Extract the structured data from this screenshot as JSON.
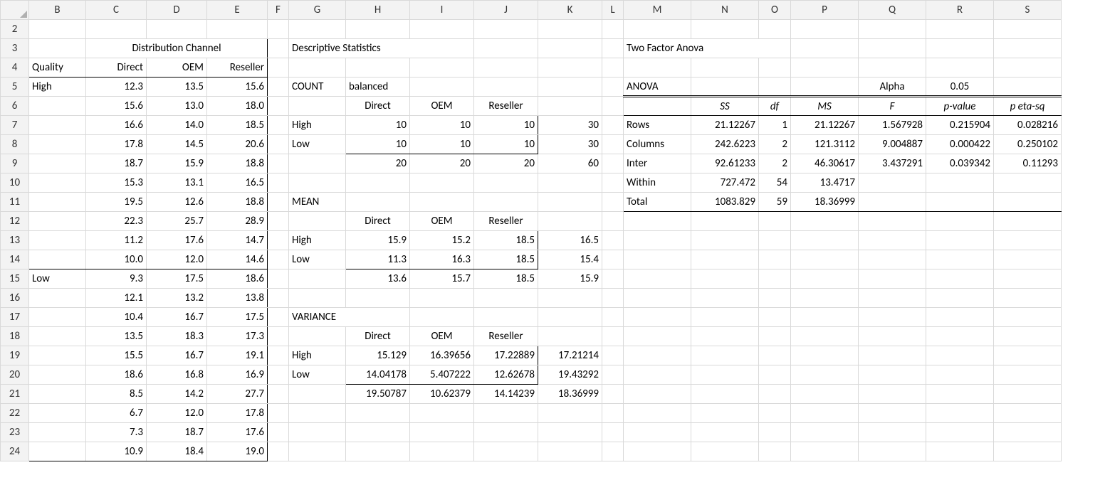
{
  "columns": [
    "B",
    "C",
    "D",
    "E",
    "F",
    "G",
    "H",
    "I",
    "J",
    "K",
    "L",
    "M",
    "N",
    "O",
    "P",
    "Q",
    "R",
    "S"
  ],
  "rows_shown": [
    "2",
    "3",
    "4",
    "5",
    "6",
    "7",
    "8",
    "9",
    "10",
    "11",
    "12",
    "13",
    "14",
    "15",
    "16",
    "17",
    "18",
    "19",
    "20",
    "21",
    "22",
    "23",
    "24"
  ],
  "labels": {
    "dist_channel": "Distribution Channel",
    "quality": "Quality",
    "direct": "Direct",
    "oem": "OEM",
    "reseller": "Reseller",
    "high": "High",
    "low": "Low",
    "desc_stats": "Descriptive Statistics",
    "count": "COUNT",
    "balanced": "balanced",
    "mean": "MEAN",
    "variance": "VARIANCE",
    "two_factor": "Two Factor Anova",
    "anova": "ANOVA",
    "alpha": "Alpha",
    "alpha_val": "0.05",
    "SS": "SS",
    "df": "df",
    "MS": "MS",
    "F": "F",
    "pvalue": "p-value",
    "petasq": "p eta-sq",
    "rows": "Rows",
    "cols": "Columns",
    "inter": "Inter",
    "within": "Within",
    "total": "Total"
  },
  "data": {
    "high": {
      "direct": [
        "12.3",
        "15.6",
        "16.6",
        "17.8",
        "18.7",
        "15.3",
        "19.5",
        "22.3",
        "11.2",
        "10.0"
      ],
      "oem": [
        "13.5",
        "13.0",
        "14.0",
        "14.5",
        "15.9",
        "13.1",
        "12.6",
        "25.7",
        "17.6",
        "12.0"
      ],
      "reseller": [
        "15.6",
        "18.0",
        "18.5",
        "20.6",
        "18.8",
        "16.5",
        "18.8",
        "28.9",
        "14.7",
        "14.6"
      ]
    },
    "low": {
      "direct": [
        "9.3",
        "12.1",
        "10.4",
        "13.5",
        "15.5",
        "18.6",
        "8.5",
        "6.7",
        "7.3",
        "10.9"
      ],
      "oem": [
        "17.5",
        "13.2",
        "16.7",
        "18.3",
        "16.7",
        "16.8",
        "14.2",
        "12.0",
        "18.7",
        "18.4"
      ],
      "reseller": [
        "18.6",
        "13.8",
        "17.5",
        "17.3",
        "19.1",
        "16.9",
        "27.7",
        "17.8",
        "17.6",
        "19.0"
      ]
    }
  },
  "count": {
    "high": {
      "direct": "10",
      "oem": "10",
      "reseller": "10",
      "total": "30"
    },
    "low": {
      "direct": "10",
      "oem": "10",
      "reseller": "10",
      "total": "30"
    },
    "col": {
      "direct": "20",
      "oem": "20",
      "reseller": "20",
      "total": "60"
    }
  },
  "mean": {
    "high": {
      "direct": "15.9",
      "oem": "15.2",
      "reseller": "18.5",
      "total": "16.5"
    },
    "low": {
      "direct": "11.3",
      "oem": "16.3",
      "reseller": "18.5",
      "total": "15.4"
    },
    "col": {
      "direct": "13.6",
      "oem": "15.7",
      "reseller": "18.5",
      "total": "15.9"
    }
  },
  "variance": {
    "high": {
      "direct": "15.129",
      "oem": "16.39656",
      "reseller": "17.22889",
      "total": "17.21214"
    },
    "low": {
      "direct": "14.04178",
      "oem": "5.407222",
      "reseller": "12.62678",
      "total": "19.43292"
    },
    "col": {
      "direct": "19.50787",
      "oem": "10.62379",
      "reseller": "14.14239",
      "total": "18.36999"
    }
  },
  "anova": {
    "rows": {
      "ss": "21.12267",
      "df": "1",
      "ms": "21.12267",
      "f": "1.567928",
      "p": "0.215904",
      "eta": "0.028216"
    },
    "columns": {
      "ss": "242.6223",
      "df": "2",
      "ms": "121.3112",
      "f": "9.004887",
      "p": "0.000422",
      "eta": "0.250102"
    },
    "inter": {
      "ss": "92.61233",
      "df": "2",
      "ms": "46.30617",
      "f": "3.437291",
      "p": "0.039342",
      "eta": "0.11293"
    },
    "within": {
      "ss": "727.472",
      "df": "54",
      "ms": "13.4717"
    },
    "total": {
      "ss": "1083.829",
      "df": "59",
      "ms": "18.36999"
    }
  }
}
